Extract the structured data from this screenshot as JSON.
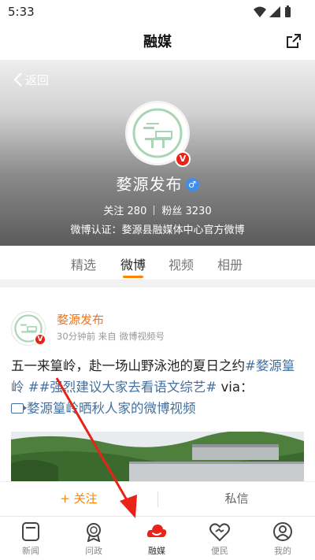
{
  "status_bar": {
    "time": "5:33"
  },
  "header": {
    "title": "融媒"
  },
  "profile": {
    "back_label": "返回",
    "name": "婺源发布",
    "verified_mark": "V",
    "gender_symbol": "♂",
    "following_label": "关注",
    "following_count": "280",
    "followers_label": "粉丝",
    "followers_count": "3230",
    "certification": "微博认证：婺源县融媒体中心官方微博"
  },
  "tabs": [
    {
      "label": "精选"
    },
    {
      "label": "微博"
    },
    {
      "label": "视频"
    },
    {
      "label": "相册"
    }
  ],
  "active_tab": "微博",
  "post": {
    "author": "婺源发布",
    "meta": "30分钟前 来自 微博视频号",
    "text_plain": "五一来篁岭，赴一场山野泳池的夏日之约",
    "tag1": "#婺源篁岭 #",
    "tag2": "#强烈建议大家去看语文综艺#",
    "via": " via：",
    "video_link": "婺源篁岭晒秋人家的微博视频"
  },
  "actions": {
    "follow": "+ 关注",
    "message": "私信"
  },
  "bottom_nav": [
    {
      "label": "新闻",
      "icon": "news-icon"
    },
    {
      "label": "问政",
      "icon": "inquiry-badge-icon"
    },
    {
      "label": "融媒",
      "icon": "cloud-media-icon"
    },
    {
      "label": "便民",
      "icon": "heart-handshake-icon"
    },
    {
      "label": "我的",
      "icon": "user-icon"
    }
  ],
  "active_nav": "融媒",
  "colors": {
    "accent_orange": "#ff8200",
    "author_orange": "#f0751c",
    "link_blue": "#43709e",
    "nav_active_red": "#e8231a",
    "annotation_red": "#e8231a"
  }
}
